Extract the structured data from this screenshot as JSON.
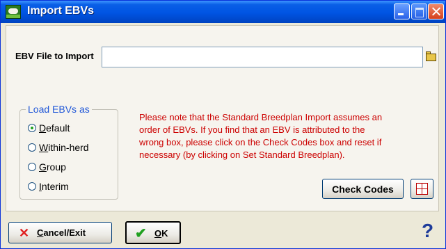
{
  "window": {
    "title": "Import EBVs",
    "icon": "sheep-app-icon"
  },
  "file": {
    "label": "EBV File to Import",
    "value": "",
    "browse_icon": "folder-open-icon"
  },
  "load_as": {
    "legend": "Load EBVs as",
    "options": [
      {
        "pre": "",
        "key": "D",
        "rest": "efault",
        "checked": true
      },
      {
        "pre": "",
        "key": "W",
        "rest": "ithin-herd",
        "checked": false
      },
      {
        "pre": "",
        "key": "G",
        "rest": "roup",
        "checked": false
      },
      {
        "pre": "",
        "key": "I",
        "rest": "nterim",
        "checked": false
      }
    ]
  },
  "note": {
    "lines": [
      "Please note that the Standard Breedplan Import assumes an",
      "order of EBVs. If you find that an EBV is attributed to the",
      "wrong box, please click on the Check Codes box and reset if",
      "necessary (by clicking on Set Standard Breedplan)."
    ]
  },
  "buttons": {
    "check_codes": "Check Codes",
    "check_codes_icon": "grid-table-icon",
    "cancel_key": "C",
    "cancel_rest": "ancel/Exit",
    "ok_key": "O",
    "ok_rest": "K",
    "help": "?"
  },
  "colors": {
    "title_bar": "#0054e3",
    "note_text": "#cc0000",
    "legend_text": "#2057d8"
  }
}
